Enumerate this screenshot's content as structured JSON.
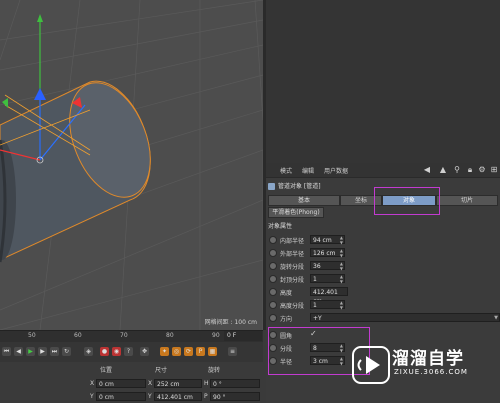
{
  "viewport": {
    "grid_spacing_label": "网格间距 : 100 cm"
  },
  "attributes": {
    "menu": [
      "模式",
      "编辑",
      "用户数据"
    ],
    "toolbar_icons": [
      "back-arrow-icon",
      "up-arrow-icon",
      "search-icon",
      "lock-icon",
      "settings-icon",
      "plus-icon"
    ],
    "object_title": "管道对象 [管道]",
    "tabs": [
      "基本",
      "坐标",
      "对象",
      "切片"
    ],
    "active_tab": "对象",
    "smooth_tab": "平滑着色(Phong)",
    "section_title": "对象属性",
    "properties": [
      {
        "label": "内部半径",
        "value": "94 cm"
      },
      {
        "label": "外部半径",
        "value": "126 cm"
      },
      {
        "label": "旋转分段",
        "value": "36"
      },
      {
        "label": "封顶分段",
        "value": "1"
      },
      {
        "label": "高度",
        "value": "412.401 cm"
      },
      {
        "label": "高度分段",
        "value": "1"
      },
      {
        "label": "方向",
        "value": "+Y"
      }
    ],
    "fillet": [
      {
        "label": "圆角",
        "value": "✓"
      },
      {
        "label": "分段",
        "value": "8"
      },
      {
        "label": "半径",
        "value": "3 cm"
      }
    ],
    "highlight_color": "#c23bd0"
  },
  "timeline": {
    "ticks": [
      "50",
      "60",
      "70",
      "80",
      "90"
    ],
    "frame_value": "0 F"
  },
  "coordinates": {
    "headers": [
      "位置",
      "尺寸",
      "旋转"
    ],
    "rows": [
      {
        "axis": "X",
        "pos": "0 cm",
        "size_axis": "X",
        "size": "252 cm",
        "rot_axis": "H",
        "rot": "0 °"
      },
      {
        "axis": "Y",
        "pos": "0 cm",
        "size_axis": "Y",
        "size": "412.401 cm",
        "rot_axis": "P",
        "rot": "90 °"
      }
    ]
  },
  "watermark": {
    "title": "溜溜自学",
    "url": "ZIXUE.3066.COM"
  }
}
